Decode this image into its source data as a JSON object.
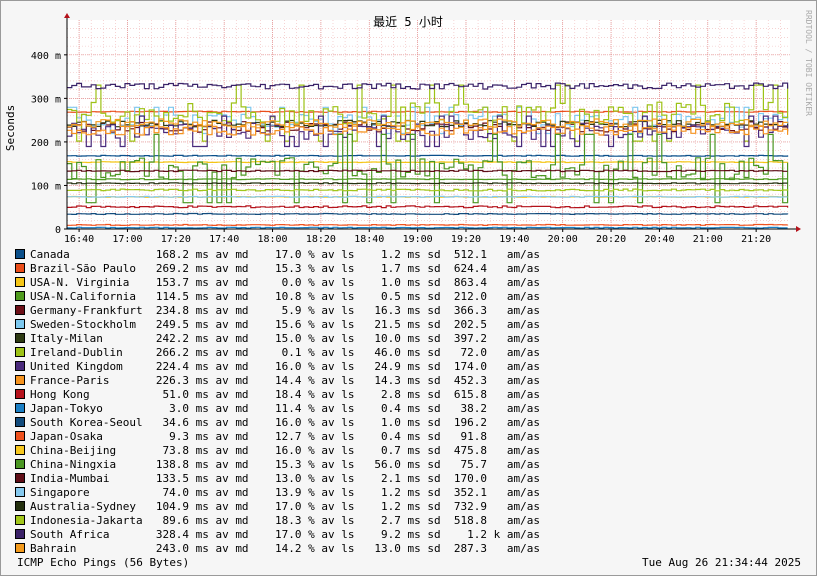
{
  "chart_data": {
    "type": "line",
    "title": "最近 5 小时",
    "ylabel": "Seconds",
    "watermark": "RRDTOOL / TOBI OETIKER",
    "y_ticks": [
      {
        "value": 0,
        "label": "0"
      },
      {
        "value": 0.1,
        "label": "100 m"
      },
      {
        "value": 0.2,
        "label": "200 m"
      },
      {
        "value": 0.3,
        "label": "300 m"
      },
      {
        "value": 0.4,
        "label": "400 m"
      }
    ],
    "ylim": [
      0,
      0.48
    ],
    "x_ticks": [
      "16:40",
      "17:00",
      "17:20",
      "17:40",
      "18:00",
      "18:20",
      "18:40",
      "19:00",
      "19:20",
      "19:40",
      "20:00",
      "20:20",
      "20:40",
      "21:00",
      "21:20"
    ],
    "xlim": [
      "16:35",
      "21:34"
    ],
    "grid": true,
    "series": [
      {
        "name": "Canada",
        "color": "#0b4f8a",
        "avg": 168.2,
        "loss": 17.0,
        "sd": 1.2,
        "amps": 512.1,
        "stats": "168.2 ms av md    17.0 % av ls    1.2 ms sd  512.1   am/as"
      },
      {
        "name": "Brazil-São Paulo",
        "color": "#ea4d1a",
        "avg": 269.2,
        "loss": 15.3,
        "sd": 1.7,
        "amps": 624.4,
        "stats": "269.2 ms av md    15.3 % av ls    1.7 ms sd  624.4   am/as"
      },
      {
        "name": "USA-N. Virginia",
        "color": "#f4c516",
        "avg": 153.7,
        "loss": 0.0,
        "sd": 1.0,
        "amps": 863.4,
        "stats": "153.7 ms av md     0.0 % av ls    1.0 ms sd  863.4   am/as"
      },
      {
        "name": "USA-N.California",
        "color": "#4e9a1d",
        "avg": 114.5,
        "loss": 10.8,
        "sd": 0.5,
        "amps": 212.0,
        "stats": "114.5 ms av md    10.8 % av ls    0.5 ms sd  212.0   am/as"
      },
      {
        "name": "Germany-Frankfurt",
        "color": "#6d0f17",
        "avg": 234.8,
        "loss": 5.9,
        "sd": 16.3,
        "amps": 366.3,
        "stats": "234.8 ms av md     5.9 % av ls   16.3 ms sd  366.3   am/as"
      },
      {
        "name": "Sweden-Stockholm",
        "color": "#7dc8ef",
        "avg": 249.5,
        "loss": 15.6,
        "sd": 21.5,
        "amps": 202.5,
        "stats": "249.5 ms av md    15.6 % av ls   21.5 ms sd  202.5   am/as"
      },
      {
        "name": "Italy-Milan",
        "color": "#2d3a12",
        "avg": 242.2,
        "loss": 15.0,
        "sd": 10.0,
        "amps": 397.2,
        "stats": "242.2 ms av md    15.0 % av ls   10.0 ms sd  397.2   am/as"
      },
      {
        "name": "Ireland-Dublin",
        "color": "#9dc216",
        "avg": 266.2,
        "loss": 0.1,
        "sd": 46.0,
        "amps": 72.0,
        "stats": "266.2 ms av md     0.1 % av ls   46.0 ms sd   72.0   am/as"
      },
      {
        "name": "United Kingdom",
        "color": "#4a2a7c",
        "avg": 224.4,
        "loss": 16.0,
        "sd": 24.9,
        "amps": 174.0,
        "stats": "224.4 ms av md    16.0 % av ls   24.9 ms sd  174.0   am/as"
      },
      {
        "name": "France-Paris",
        "color": "#f5921e",
        "avg": 226.3,
        "loss": 14.4,
        "sd": 14.3,
        "amps": 452.3,
        "stats": "226.3 ms av md    14.4 % av ls   14.3 ms sd  452.3   am/as"
      },
      {
        "name": "Hong Kong",
        "color": "#b5121b",
        "avg": 51.0,
        "loss": 18.4,
        "sd": 2.8,
        "amps": 615.8,
        "stats": " 51.0 ms av md    18.4 % av ls    2.8 ms sd  615.8   am/as"
      },
      {
        "name": "Japan-Tokyo",
        "color": "#1b7fc4",
        "avg": 3.0,
        "loss": 11.4,
        "sd": 0.4,
        "amps": 38.2,
        "stats": "  3.0 ms av md    11.4 % av ls    0.4 ms sd   38.2   am/as"
      },
      {
        "name": "South Korea-Seoul",
        "color": "#124b7c",
        "avg": 34.6,
        "loss": 16.0,
        "sd": 1.0,
        "amps": 196.2,
        "stats": " 34.6 ms av md    16.0 % av ls    1.0 ms sd  196.2   am/as"
      },
      {
        "name": "Japan-Osaka",
        "color": "#f0521e",
        "avg": 9.3,
        "loss": 12.7,
        "sd": 0.4,
        "amps": 91.8,
        "stats": "  9.3 ms av md    12.7 % av ls    0.4 ms sd   91.8   am/as"
      },
      {
        "name": "China-Beijing",
        "color": "#f7c81f",
        "avg": 73.8,
        "loss": 16.0,
        "sd": 0.7,
        "amps": 475.8,
        "stats": " 73.8 ms av md    16.0 % av ls    0.7 ms sd  475.8   am/as"
      },
      {
        "name": "China-Ningxia",
        "color": "#4a9622",
        "avg": 138.8,
        "loss": 15.3,
        "sd": 56.0,
        "amps": 75.7,
        "stats": "138.8 ms av md    15.3 % av ls   56.0 ms sd   75.7   am/as"
      },
      {
        "name": "India-Mumbai",
        "color": "#5f0d16",
        "avg": 133.5,
        "loss": 13.0,
        "sd": 2.1,
        "amps": 170.0,
        "stats": "133.5 ms av md    13.0 % av ls    2.1 ms sd  170.0   am/as"
      },
      {
        "name": "Singapore",
        "color": "#86c9ee",
        "avg": 74.0,
        "loss": 13.9,
        "sd": 1.2,
        "amps": 352.1,
        "stats": " 74.0 ms av md    13.9 % av ls    1.2 ms sd  352.1   am/as"
      },
      {
        "name": "Australia-Sydney",
        "color": "#24300e",
        "avg": 104.9,
        "loss": 17.0,
        "sd": 1.2,
        "amps": 732.9,
        "stats": "104.9 ms av md    17.0 % av ls    1.2 ms sd  732.9   am/as"
      },
      {
        "name": "Indonesia-Jakarta",
        "color": "#a2c61a",
        "avg": 89.6,
        "loss": 18.3,
        "sd": 2.7,
        "amps": 518.8,
        "stats": " 89.6 ms av md    18.3 % av ls    2.7 ms sd  518.8   am/as"
      },
      {
        "name": "South Africa",
        "color": "#3b2268",
        "avg": 328.4,
        "loss": 17.0,
        "sd": 9.2,
        "amps": 1200,
        "stats": "328.4 ms av md    17.0 % av ls    9.2 ms sd    1.2 k am/as"
      },
      {
        "name": "Bahrain",
        "color": "#f39a1c",
        "avg": 243.0,
        "loss": 14.2,
        "sd": 13.0,
        "amps": 287.3,
        "stats": "243.0 ms av md    14.2 % av ls   13.0 ms sd  287.3   am/as"
      }
    ],
    "footer_left": "ICMP Echo Pings (56 Bytes)",
    "footer_right": "Tue Aug 26 21:34:44 2025"
  }
}
